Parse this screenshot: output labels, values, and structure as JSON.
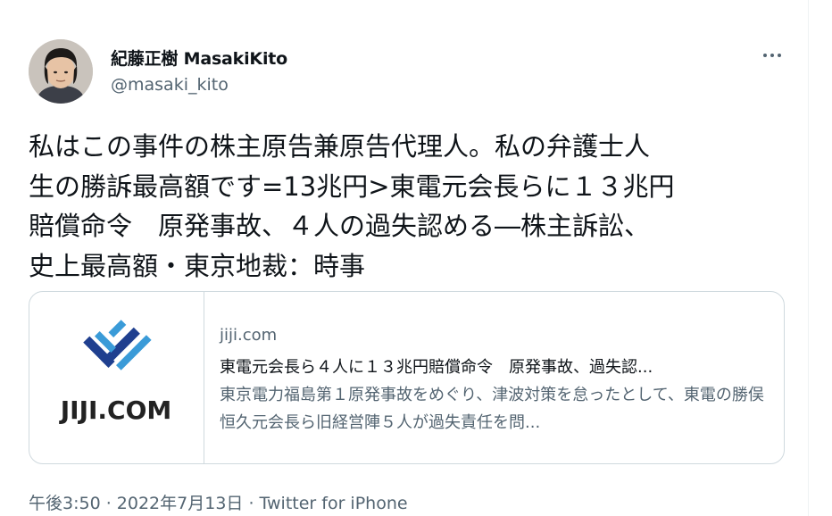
{
  "author": {
    "display_name": "紀藤正樹 MasakiKito",
    "handle": "@masaki_kito"
  },
  "icons": {
    "more": "more-horizontal-icon",
    "avatar": "user-avatar",
    "card_logo": "jiji-logo"
  },
  "tweet": {
    "text": "私はこの事件の株主原告兼原告代理人。私の弁護士人\n生の勝訴最高額です=13兆円>東電元会長らに１３兆円\n賠償命令　原発事故、４人の過失認める―株主訴訟、\n史上最高額・東京地裁：時事"
  },
  "card": {
    "logo_text": "JIJI.COM",
    "domain": "jiji.com",
    "title": "東電元会長ら４人に１３兆円賠償命令　原発事故、過失認...",
    "description": "東京電力福島第１原発事故をめぐり、津波対策を怠ったとして、東電の勝俣恒久元会長ら旧経営陣５人が過失責任を問..."
  },
  "meta": {
    "time": "午後3:50",
    "separator": " · ",
    "date": "2022年7月13日",
    "source": "Twitter for iPhone"
  },
  "colors": {
    "text": "#0f1419",
    "secondary": "#536471",
    "border": "#cfd9de",
    "logo_blue_dark": "#1f3f8f",
    "logo_blue_light": "#3a9bd8"
  }
}
